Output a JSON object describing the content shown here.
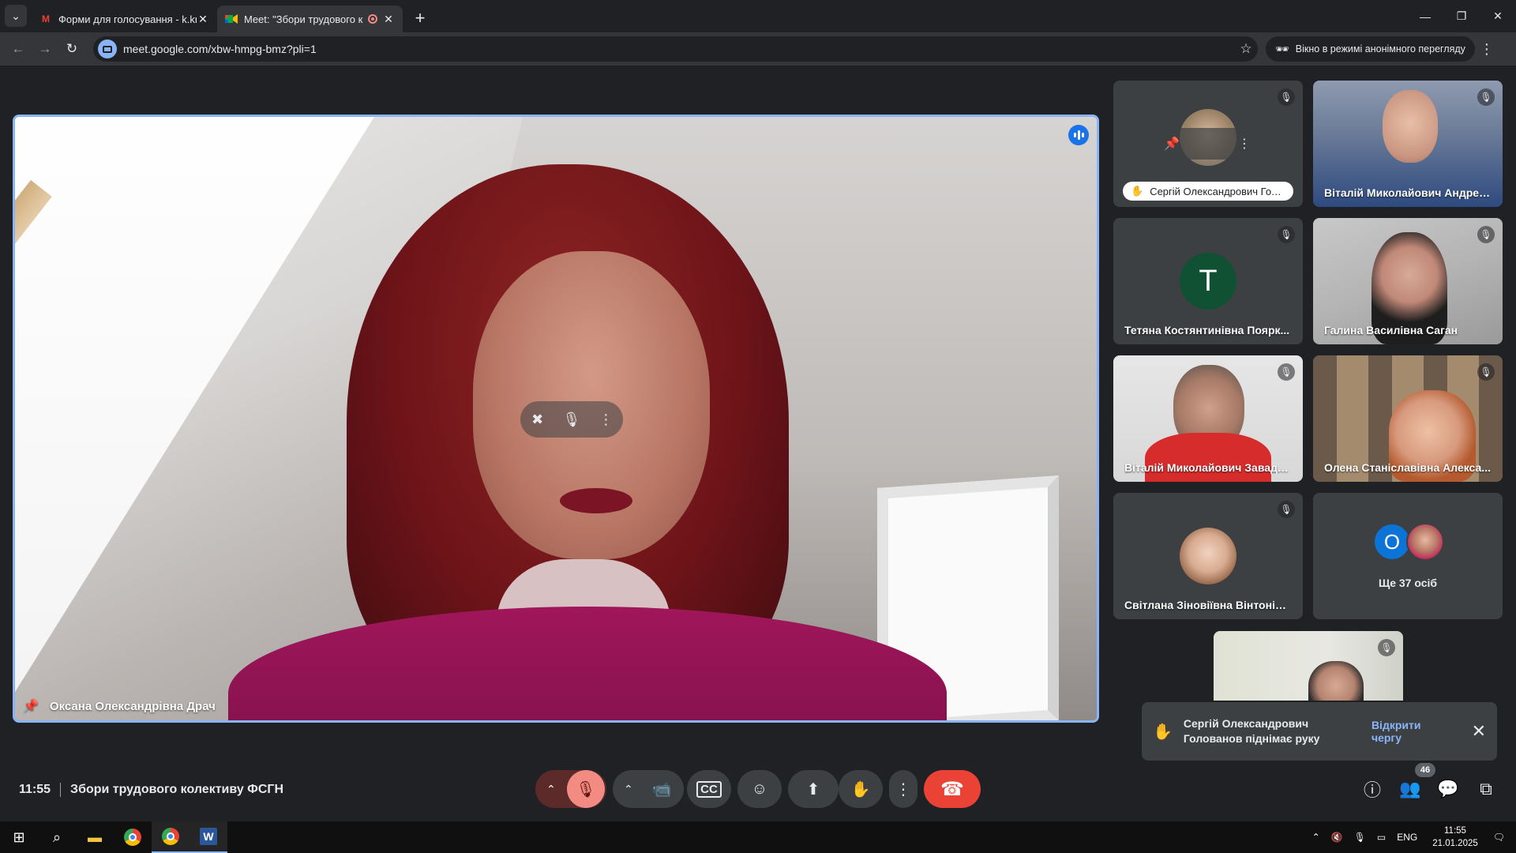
{
  "browser": {
    "tabs": [
      {
        "title": "Форми для голосування - k.kr",
        "favicon": "gmail-icon"
      },
      {
        "title": "Meet: \"Збори трудового ко",
        "favicon": "meet-icon",
        "recording": true
      }
    ],
    "url": "meet.google.com/xbw-hmpg-bmz?pli=1",
    "incognito_label": "Вікно в режимі анонімного перегляду"
  },
  "main_tile": {
    "name": "Оксана Олександрівна Драч"
  },
  "participants": [
    {
      "name": "Сергій Олександрович Гол...",
      "hand_raised": true
    },
    {
      "name": "Віталій Миколайович Андреєв"
    },
    {
      "name": "Тетяна Костянтинівна Поярк...",
      "avatar_letter": "Т",
      "avatar_color": "#0f5132"
    },
    {
      "name": "Галина Василівна Саган"
    },
    {
      "name": "Віталій Миколайович Завадс..."
    },
    {
      "name": "Олена Станіславівна Алекса..."
    },
    {
      "name": "Світлана Зіновіївна Вінтонів-..."
    },
    {
      "name": "Ще 37 осіб",
      "avatar_letter": "О",
      "avatar_color": "#0b74d6"
    }
  ],
  "notification": {
    "message": "Сергій Олександрович Голованов піднімає руку",
    "action": "Відкрити чергу"
  },
  "meeting": {
    "time": "11:55",
    "title": "Збори трудового колективу ФСГН",
    "people_count": "46"
  },
  "taskbar": {
    "lang": "ENG",
    "time": "11:55",
    "date": "21.01.2025"
  },
  "colors": {
    "accent": "#8ab4f8",
    "end_call": "#ea4335",
    "mic_off": "#f28b82"
  }
}
